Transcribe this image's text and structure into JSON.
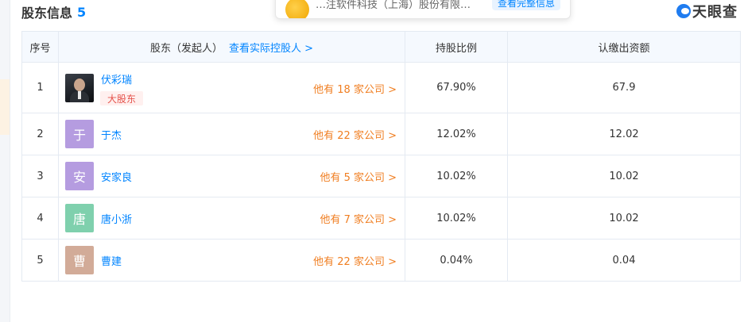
{
  "header": {
    "section_title": "股东信息",
    "section_count": "5",
    "popup_text": "…注软件科技（上海）股份有限…",
    "popup_button": "查看完整信息",
    "logo_text": "天眼查"
  },
  "table": {
    "columns": {
      "index": "序号",
      "holder": "股东（发起人）",
      "holder_link": "查看实际控股人 >",
      "ratio": "持股比例",
      "capital": "认缴出资额"
    },
    "rows": [
      {
        "index": "1",
        "avatar": "photo",
        "name": "伏彩瑞",
        "tag": "大股东",
        "companies": "他有 18 家公司 >",
        "ratio": "67.90%",
        "capital": "67.9"
      },
      {
        "index": "2",
        "avatar": "于",
        "name": "于杰",
        "companies": "他有 22 家公司 >",
        "ratio": "12.02%",
        "capital": "12.02"
      },
      {
        "index": "3",
        "avatar": "安",
        "name": "安家良",
        "companies": "他有 5 家公司 >",
        "ratio": "10.02%",
        "capital": "10.02"
      },
      {
        "index": "4",
        "avatar": "唐",
        "name": "唐小浙",
        "companies": "他有 7 家公司 >",
        "ratio": "10.02%",
        "capital": "10.02"
      },
      {
        "index": "5",
        "avatar": "曹",
        "name": "曹建",
        "companies": "他有 22 家公司 >",
        "ratio": "0.04%",
        "capital": "0.04"
      }
    ]
  },
  "colors": {
    "link": "#0084ff",
    "company_link": "#f07e21",
    "avatar_2": "#b59ce0",
    "avatar_3": "#b59ce0",
    "avatar_4": "#7fd0ad",
    "avatar_5": "#d2ab98",
    "badge_text": "#e5524b",
    "header_bg": "#f5f9fe"
  }
}
